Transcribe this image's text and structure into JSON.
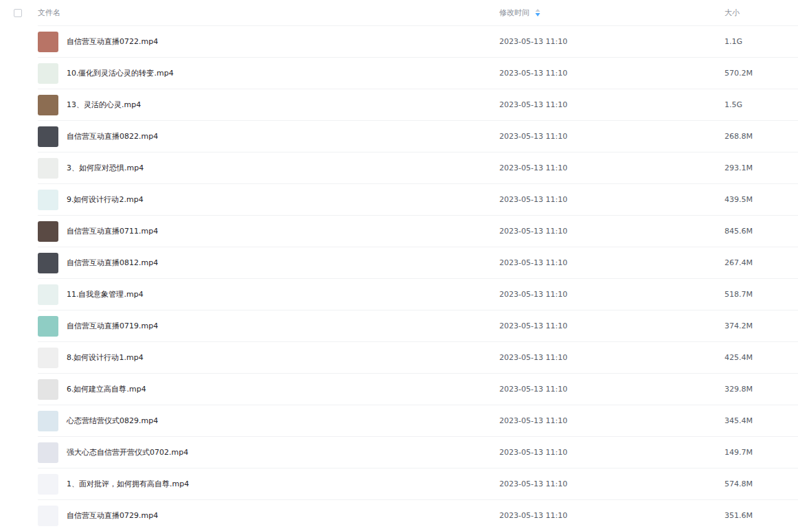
{
  "header": {
    "checked": false,
    "columns": [
      {
        "label": "文件名",
        "sorted": false
      },
      {
        "label": "修改时间",
        "sorted": true
      },
      {
        "label": "大小",
        "sorted": false
      }
    ]
  },
  "rows": [
    {
      "name": "自信营互动直播0722.mp4",
      "modified": "2023-05-13 11:10",
      "size": "1.1G",
      "selected": false,
      "color": "#b87466"
    },
    {
      "name": "10.僵化到灵活心灵的转变.mp4",
      "modified": "2023-05-13 11:10",
      "size": "570.2M",
      "selected": false,
      "color": "#e6efe8"
    },
    {
      "name": "13、灵活的心灵.mp4",
      "modified": "2023-05-13 11:10",
      "size": "1.5G",
      "selected": false,
      "color": "#8c6d52"
    },
    {
      "name": "自信营互动直播0822.mp4",
      "modified": "2023-05-13 11:10",
      "size": "268.8M",
      "selected": false,
      "color": "#4a4d55"
    },
    {
      "name": "3、如何应对恐惧.mp4",
      "modified": "2023-05-13 11:10",
      "size": "293.1M",
      "selected": false,
      "color": "#eceeec"
    },
    {
      "name": "9.如何设计行动2.mp4",
      "modified": "2023-05-13 11:10",
      "size": "439.5M",
      "selected": false,
      "color": "#e3f1f2"
    },
    {
      "name": "自信营互动直播0711.mp4",
      "modified": "2023-05-13 11:10",
      "size": "845.6M",
      "selected": false,
      "color": "#5a4a44"
    },
    {
      "name": "自信营互动直播0812.mp4",
      "modified": "2023-05-13 11:10",
      "size": "267.4M",
      "selected": false,
      "color": "#4a4d55"
    },
    {
      "name": "11.自我意象管理.mp4",
      "modified": "2023-05-13 11:10",
      "size": "518.7M",
      "selected": false,
      "color": "#e7f1ef"
    },
    {
      "name": "自信营互动直播0719.mp4",
      "modified": "2023-05-13 11:10",
      "size": "374.2M",
      "selected": false,
      "color": "#8fcdc4"
    },
    {
      "name": "8.如何设计行动1.mp4",
      "modified": "2023-05-13 11:10",
      "size": "425.4M",
      "selected": false,
      "color": "#efefef"
    },
    {
      "name": "6.如何建立高自尊.mp4",
      "modified": "2023-05-13 11:10",
      "size": "329.8M",
      "selected": false,
      "color": "#e4e4e4"
    },
    {
      "name": "心态营结营仪式0829.mp4",
      "modified": "2023-05-13 11:10",
      "size": "345.4M",
      "selected": false,
      "color": "#dbe7ef"
    },
    {
      "name": "强大心态自信营开营仪式0702.mp4",
      "modified": "2023-05-13 11:10",
      "size": "149.7M",
      "selected": false,
      "color": "#e2e4ec"
    },
    {
      "name": "1、面对批评，如何拥有高自尊.mp4",
      "modified": "2023-05-13 11:10",
      "size": "574.8M",
      "selected": false,
      "color": "#f3f4f8"
    },
    {
      "name": "自信营互动直播0729.mp4",
      "modified": "2023-05-13 11:10",
      "size": "351.6M",
      "selected": false,
      "color": "#f3f4f8"
    }
  ]
}
